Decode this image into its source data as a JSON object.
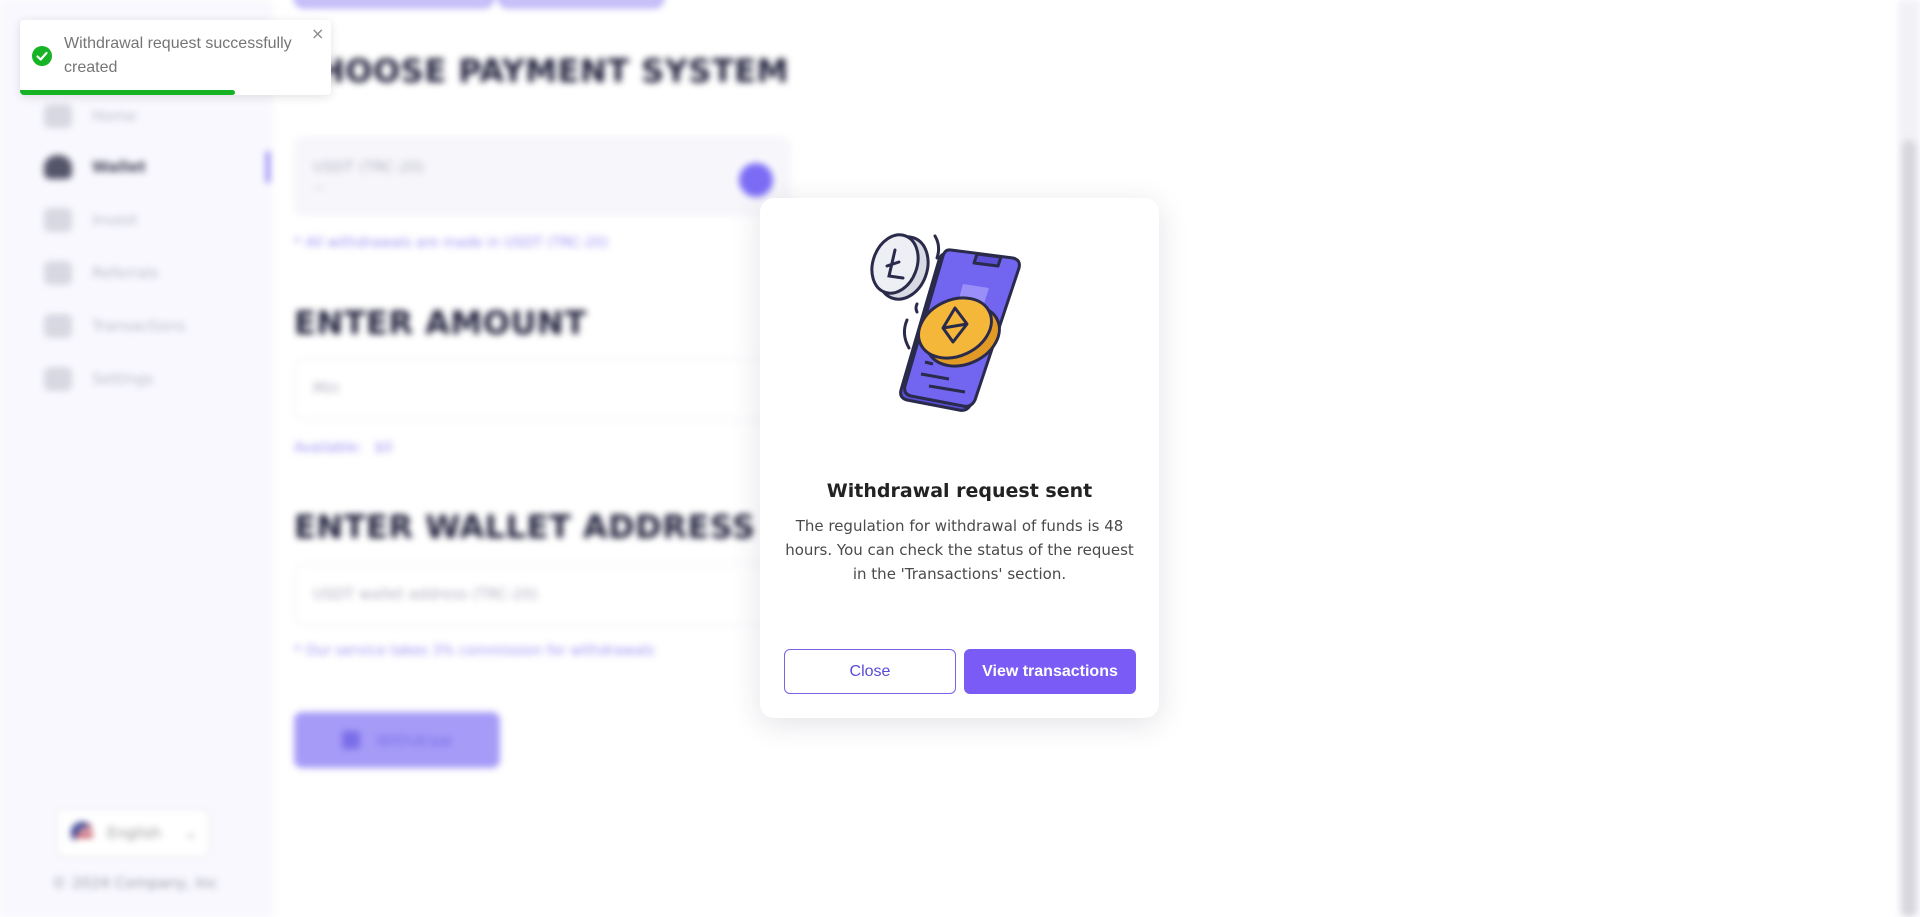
{
  "sidebar": {
    "items": [
      {
        "label": "Home",
        "icon": "home-icon"
      },
      {
        "label": "Wallet",
        "icon": "wallet-icon"
      },
      {
        "label": "Invest",
        "icon": "invest-icon"
      },
      {
        "label": "Referrals",
        "icon": "referrals-icon"
      },
      {
        "label": "Transactions",
        "icon": "transactions-icon"
      },
      {
        "label": "Settings",
        "icon": "settings-icon"
      }
    ],
    "language": "English",
    "copyright": "© 2024 Company, Inc"
  },
  "main": {
    "payment_title": "CHOOSE PAYMENT SYSTEM",
    "payment_selected": "USDT (TRC-20)",
    "payment_sub": "—",
    "payment_note": "* All withdrawals are made in USDT (TRC-20)",
    "amount_title": "ENTER AMOUNT",
    "amount_placeholder": "Min",
    "available_label": "Available:",
    "available_value": "$0",
    "wallet_title": "ENTER WALLET ADDRESS",
    "wallet_placeholder": "USDT wallet address (TRC-20)",
    "commission_note": "* Our service takes 3% commission for withdrawals",
    "withdraw_button": "Withdraw"
  },
  "modal": {
    "title": "Withdrawal request sent",
    "text": "The regulation for withdrawal of funds is 48 hours. You can check the status of the request in the 'Transactions' section.",
    "close_label": "Close",
    "view_label": "View transactions"
  },
  "toast": {
    "message": "Withdrawal request successfully created",
    "close_glyph": "×",
    "progress": 0.69,
    "color": "#16b325"
  },
  "colors": {
    "accent": "#7a5bf5",
    "success": "#16b325"
  }
}
